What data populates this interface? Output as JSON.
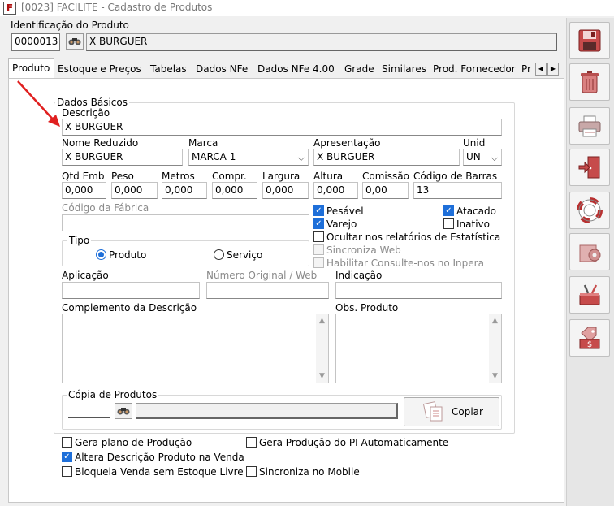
{
  "window": {
    "title": "[0023] FACILITE - Cadastro de Produtos"
  },
  "ident": {
    "group_label": "Identificação do Produto",
    "code": "0000013",
    "name": "X BURGUER"
  },
  "tabs": [
    {
      "label": "Produto"
    },
    {
      "label": "Estoque e Preços"
    },
    {
      "label": "Tabelas"
    },
    {
      "label": "Dados NFe"
    },
    {
      "label": "Dados NFe 4.00"
    },
    {
      "label": "Grade"
    },
    {
      "label": "Similares"
    },
    {
      "label": "Prod. Fornecedor"
    },
    {
      "label": "Pr"
    }
  ],
  "basic": {
    "group_label": "Dados Básicos",
    "descricao_label": "Descrição",
    "descricao": "X BURGUER",
    "nome_reduzido_label": "Nome Reduzido",
    "nome_reduzido": "X BURGUER",
    "marca_label": "Marca",
    "marca": "MARCA 1",
    "apresentacao_label": "Apresentação",
    "apresentacao": "X BURGUER",
    "unid_label": "Unid",
    "unid": "UN",
    "qtd_emb_label": "Qtd Emb",
    "qtd_emb": "0,000",
    "peso_label": "Peso",
    "peso": "0,000",
    "metros_label": "Metros",
    "metros": "0,000",
    "compr_label": "Compr.",
    "compr": "0,000",
    "largura_label": "Largura",
    "largura": "0,000",
    "altura_label": "Altura",
    "altura": "0,000",
    "comissao_label": "Comissão",
    "comissao": "0,00",
    "codigo_barras_label": "Código de Barras",
    "codigo_barras": "13",
    "codigo_fabrica_label": "Código da Fábrica",
    "codigo_fabrica": "",
    "tipo_label": "Tipo",
    "tipo_produto": "Produto",
    "tipo_servico": "Serviço",
    "pesavel": "Pesável",
    "atacado": "Atacado",
    "varejo": "Varejo",
    "inativo": "Inativo",
    "ocultar": "Ocultar nos relatórios de Estatística",
    "sincroniza_web": "Sincroniza Web",
    "habilitar": "Habilitar Consulte-nos no Inpera",
    "aplicacao_label": "Aplicação",
    "numero_original_label": "Número Original / Web",
    "indicacao_label": "Indicação",
    "complemento_label": "Complemento da Descrição",
    "obs_label": "Obs. Produto"
  },
  "copia": {
    "group_label": "Cópia de Produtos",
    "button": "Copiar"
  },
  "options": {
    "gera_plano": "Gera plano de Produção",
    "gera_producao_pi": "Gera Produção do PI Automaticamente",
    "altera_descricao": "Altera Descrição Produto na Venda",
    "bloqueia_venda": "Bloqueia Venda sem Estoque Livre",
    "sincroniza_mobile": "Sincroniza no Mobile"
  },
  "sidebar_icons": [
    "save-icon",
    "trash-icon",
    "printer-icon",
    "exit-door-icon",
    "lifebuoy-icon",
    "settings-box-icon",
    "tools-icon",
    "price-tag-icon"
  ],
  "colors": {
    "accent": "#1e6fd9",
    "arrow": "#e02020"
  }
}
